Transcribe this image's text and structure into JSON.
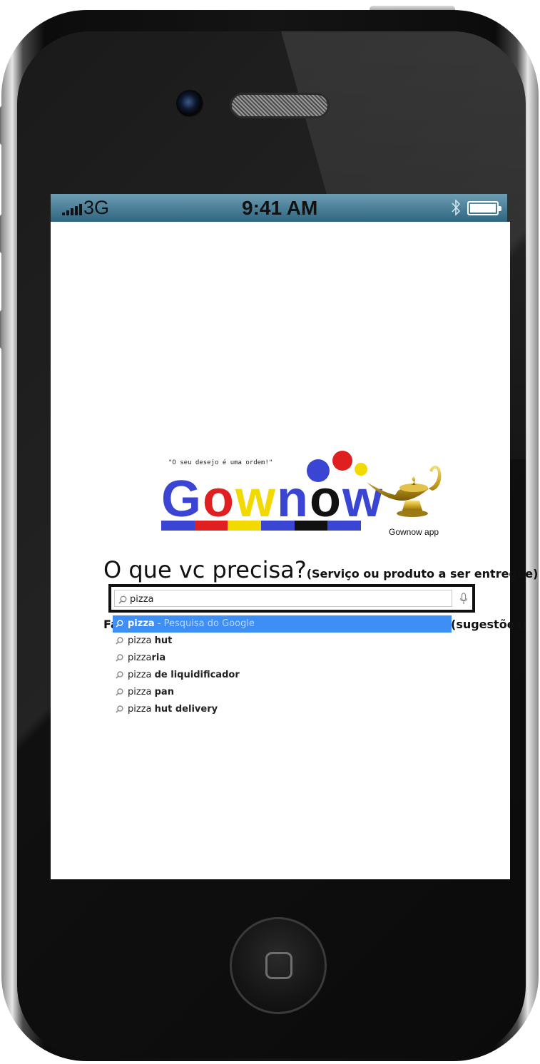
{
  "status_bar": {
    "network": "3G",
    "time": "9:41 AM"
  },
  "logo": {
    "tagline": "\"O seu desejo é uma ordem!\"",
    "parts": [
      {
        "text": "G",
        "color": "#3a45d4"
      },
      {
        "text": "o",
        "color": "#e02020"
      },
      {
        "text": "w",
        "color": "#f2d900"
      },
      {
        "text": "n",
        "color": "#3a45d4"
      },
      {
        "text": "o",
        "color": "#111111"
      },
      {
        "text": "w",
        "color": "#3a45d4"
      }
    ],
    "bar_colors": [
      "#3a45d4",
      "#e02020",
      "#f2d900",
      "#3a45d4",
      "#111111",
      "#3a45d4"
    ],
    "app_caption": "Gownow app"
  },
  "main": {
    "question": "O que vc precisa?",
    "question_hint": "(Serviço ou produto a ser entregue)",
    "behind_left": "Fa",
    "behind_right": "(sugestões)"
  },
  "search": {
    "value": "pizza",
    "suggestions": [
      {
        "prefix": "pizza",
        "bold": "",
        "hint": " - Pesquisa do Google"
      },
      {
        "prefix": "pizza ",
        "bold": "hut",
        "hint": ""
      },
      {
        "prefix": "pizza",
        "bold": "ria",
        "hint": ""
      },
      {
        "prefix": "pizza ",
        "bold": "de liquidificador",
        "hint": ""
      },
      {
        "prefix": "pizza ",
        "bold": "pan",
        "hint": ""
      },
      {
        "prefix": "pizza ",
        "bold": "hut delivery",
        "hint": ""
      }
    ]
  },
  "colors": {
    "highlight": "#3d8ef5",
    "status_bar": "#2f6580"
  }
}
